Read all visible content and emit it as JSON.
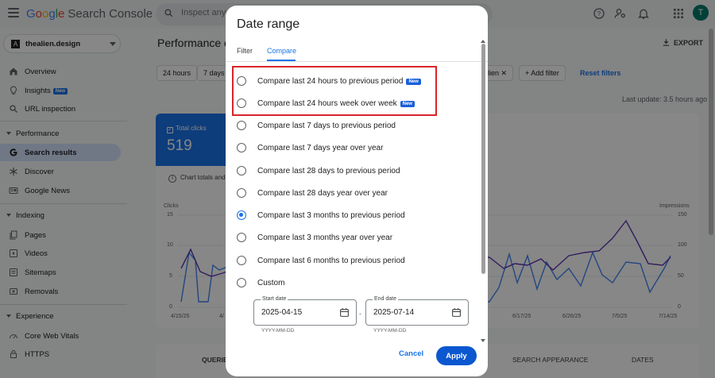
{
  "topbar": {
    "logo_google": [
      "G",
      "o",
      "o",
      "g",
      "l",
      "e"
    ],
    "logo_product": "Search Console",
    "search_placeholder": "Inspect any u",
    "avatar_letter": "T"
  },
  "sidebar": {
    "property": "thealien.design",
    "property_icon": "A",
    "items": [
      {
        "label": "Overview",
        "icon": "home-icon"
      },
      {
        "label": "Insights",
        "icon": "lightbulb-icon",
        "badge": "New"
      },
      {
        "label": "URL inspection",
        "icon": "search-icon"
      }
    ],
    "sections": [
      {
        "title": "Performance",
        "items": [
          {
            "label": "Search results",
            "icon": "google-g-icon",
            "active": true
          },
          {
            "label": "Discover",
            "icon": "asterisk-icon"
          },
          {
            "label": "Google News",
            "icon": "news-icon"
          }
        ]
      },
      {
        "title": "Indexing",
        "items": [
          {
            "label": "Pages",
            "icon": "pages-icon"
          },
          {
            "label": "Videos",
            "icon": "video-icon"
          },
          {
            "label": "Sitemaps",
            "icon": "sitemap-icon"
          },
          {
            "label": "Removals",
            "icon": "removals-icon"
          }
        ]
      },
      {
        "title": "Experience",
        "items": [
          {
            "label": "Core Web Vitals",
            "icon": "speed-icon"
          },
          {
            "label": "HTTPS",
            "icon": "lock-icon"
          }
        ]
      }
    ]
  },
  "main": {
    "title": "Performance or",
    "export": "EXPORT",
    "chips": [
      "24 hours",
      "7 days"
    ],
    "filter_chip": "lien",
    "add_filter": "Add filter",
    "reset_filters": "Reset filters",
    "last_update": "Last update: 3.5 hours ago",
    "clicks_label": "Total clicks",
    "clicks_value": "519",
    "chart_note": "Chart totals and",
    "left_axis_title": "Clicks",
    "left_ticks": [
      "15",
      "10",
      "5",
      "0"
    ],
    "right_axis_title": "Impressions",
    "right_ticks": [
      "150",
      "100",
      "50",
      "0"
    ],
    "x_ticks_left": [
      "4/15/25",
      "4/"
    ],
    "x_ticks_right": [
      "6/17/25",
      "6/26/25",
      "7/5/25",
      "7/14/25"
    ],
    "table_tabs": [
      "QUERIES",
      "SEARCH APPEARANCE",
      "DATES"
    ],
    "colors": {
      "clicks": "#4285f4",
      "impressions": "#5e35b1"
    }
  },
  "dialog": {
    "title": "Date range",
    "tabs": {
      "filter": "Filter",
      "compare": "Compare"
    },
    "options": [
      {
        "label": "Compare last 24 hours to previous period",
        "badge": "New",
        "checked": false
      },
      {
        "label": "Compare last 24 hours week over week",
        "badge": "New",
        "checked": false
      },
      {
        "label": "Compare last 7 days to previous period",
        "checked": false
      },
      {
        "label": "Compare last 7 days year over year",
        "checked": false
      },
      {
        "label": "Compare last 28 days to previous period",
        "checked": false
      },
      {
        "label": "Compare last 28 days year over year",
        "checked": false
      },
      {
        "label": "Compare last 3 months to previous period",
        "checked": true
      },
      {
        "label": "Compare last 3 months year over year",
        "checked": false
      },
      {
        "label": "Compare last 6 months to previous period",
        "checked": false
      },
      {
        "label": "Custom",
        "checked": false
      }
    ],
    "start_date": {
      "label": "Start date",
      "value": "2025-04-15",
      "hint": "YYYY-MM-DD"
    },
    "end_date": {
      "label": "End date",
      "value": "2025-07-14",
      "hint": "YYYY-MM-DD"
    },
    "date_separator": "-",
    "cancel": "Cancel",
    "apply": "Apply",
    "highlight_color": "#d9232a"
  }
}
